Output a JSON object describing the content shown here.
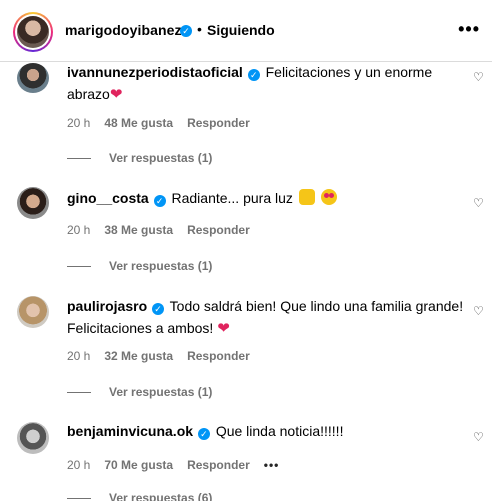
{
  "header": {
    "username": "marigodoyibanez",
    "separator": "•",
    "follow_label": "Siguiendo",
    "more_icon": "more-horizontal-icon"
  },
  "comments": [
    {
      "user": "ivannunezperiodistaoficial",
      "verified": true,
      "text": "Felicitaciones y un enorme abrazo",
      "time": "20 h",
      "likes": "48 Me gusta",
      "reply": "Responder",
      "view_replies": "Ver respuestas (1)"
    },
    {
      "user": "gino__costa",
      "verified": true,
      "text": "Radiante... pura luz",
      "time": "20 h",
      "likes": "38 Me gusta",
      "reply": "Responder",
      "view_replies": "Ver respuestas (1)"
    },
    {
      "user": "paulirojasro",
      "verified": true,
      "text": "Todo saldrá bien! Que lindo una familia grande! Felicitaciones a ambos!",
      "time": "20 h",
      "likes": "32 Me gusta",
      "reply": "Responder",
      "view_replies": "Ver respuestas (1)"
    },
    {
      "user": "benjaminvicuna.ok",
      "verified": true,
      "text": "Que linda noticia!!!!!!",
      "time": "20 h",
      "likes": "70 Me gusta",
      "reply": "Responder",
      "view_replies": "Ver respuestas (6)"
    }
  ],
  "colors": {
    "verified": "#0095f6",
    "muted": "#737373",
    "heart_emoji": "#e0245e"
  },
  "icons": {
    "like": "heart-outline-icon",
    "verified": "verified-badge-icon",
    "options": "more-horizontal-icon"
  }
}
